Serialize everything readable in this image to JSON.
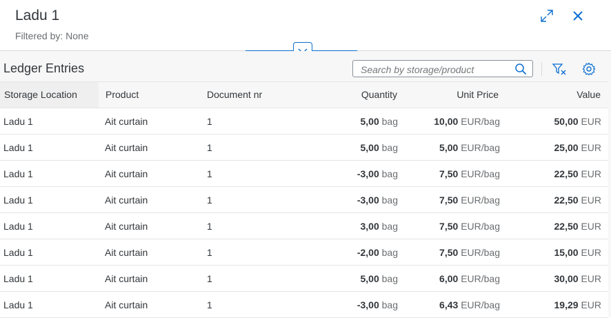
{
  "header": {
    "title": "Ladu 1",
    "subtitle": "Filtered by: None"
  },
  "table": {
    "title": "Ledger Entries",
    "search_placeholder": "Search by storage/product",
    "columns": {
      "storage_location": "Storage Location",
      "product": "Product",
      "document_nr": "Document nr",
      "quantity": "Quantity",
      "unit_price": "Unit Price",
      "value": "Value"
    },
    "rows": [
      {
        "storage": "Ladu 1",
        "product": "Ait curtain",
        "doc": "1",
        "qty": "5,00",
        "qty_unit": "bag",
        "price": "10,00",
        "price_unit": "EUR/bag",
        "value": "50,00",
        "value_unit": "EUR"
      },
      {
        "storage": "Ladu 1",
        "product": "Ait curtain",
        "doc": "1",
        "qty": "5,00",
        "qty_unit": "bag",
        "price": "5,00",
        "price_unit": "EUR/bag",
        "value": "25,00",
        "value_unit": "EUR"
      },
      {
        "storage": "Ladu 1",
        "product": "Ait curtain",
        "doc": "1",
        "qty": "-3,00",
        "qty_unit": "bag",
        "price": "7,50",
        "price_unit": "EUR/bag",
        "value": "22,50",
        "value_unit": "EUR"
      },
      {
        "storage": "Ladu 1",
        "product": "Ait curtain",
        "doc": "1",
        "qty": "-3,00",
        "qty_unit": "bag",
        "price": "7,50",
        "price_unit": "EUR/bag",
        "value": "22,50",
        "value_unit": "EUR"
      },
      {
        "storage": "Ladu 1",
        "product": "Ait curtain",
        "doc": "1",
        "qty": "3,00",
        "qty_unit": "bag",
        "price": "7,50",
        "price_unit": "EUR/bag",
        "value": "22,50",
        "value_unit": "EUR"
      },
      {
        "storage": "Ladu 1",
        "product": "Ait curtain",
        "doc": "1",
        "qty": "-2,00",
        "qty_unit": "bag",
        "price": "7,50",
        "price_unit": "EUR/bag",
        "value": "15,00",
        "value_unit": "EUR"
      },
      {
        "storage": "Ladu 1",
        "product": "Ait curtain",
        "doc": "1",
        "qty": "5,00",
        "qty_unit": "bag",
        "price": "6,00",
        "price_unit": "EUR/bag",
        "value": "30,00",
        "value_unit": "EUR"
      },
      {
        "storage": "Ladu 1",
        "product": "Ait curtain",
        "doc": "1",
        "qty": "-3,00",
        "qty_unit": "bag",
        "price": "6,43",
        "price_unit": "EUR/bag",
        "value": "19,29",
        "value_unit": "EUR"
      }
    ]
  },
  "colors": {
    "accent": "#0a6ed1",
    "text": "#32363a",
    "muted": "#6a6d70"
  },
  "icons": {
    "fullscreen": "expand-icon",
    "close": "close-icon",
    "collapse": "chevron-down-icon",
    "search": "search-icon",
    "clear_filter": "clear-filter-icon",
    "settings": "gear-icon"
  }
}
